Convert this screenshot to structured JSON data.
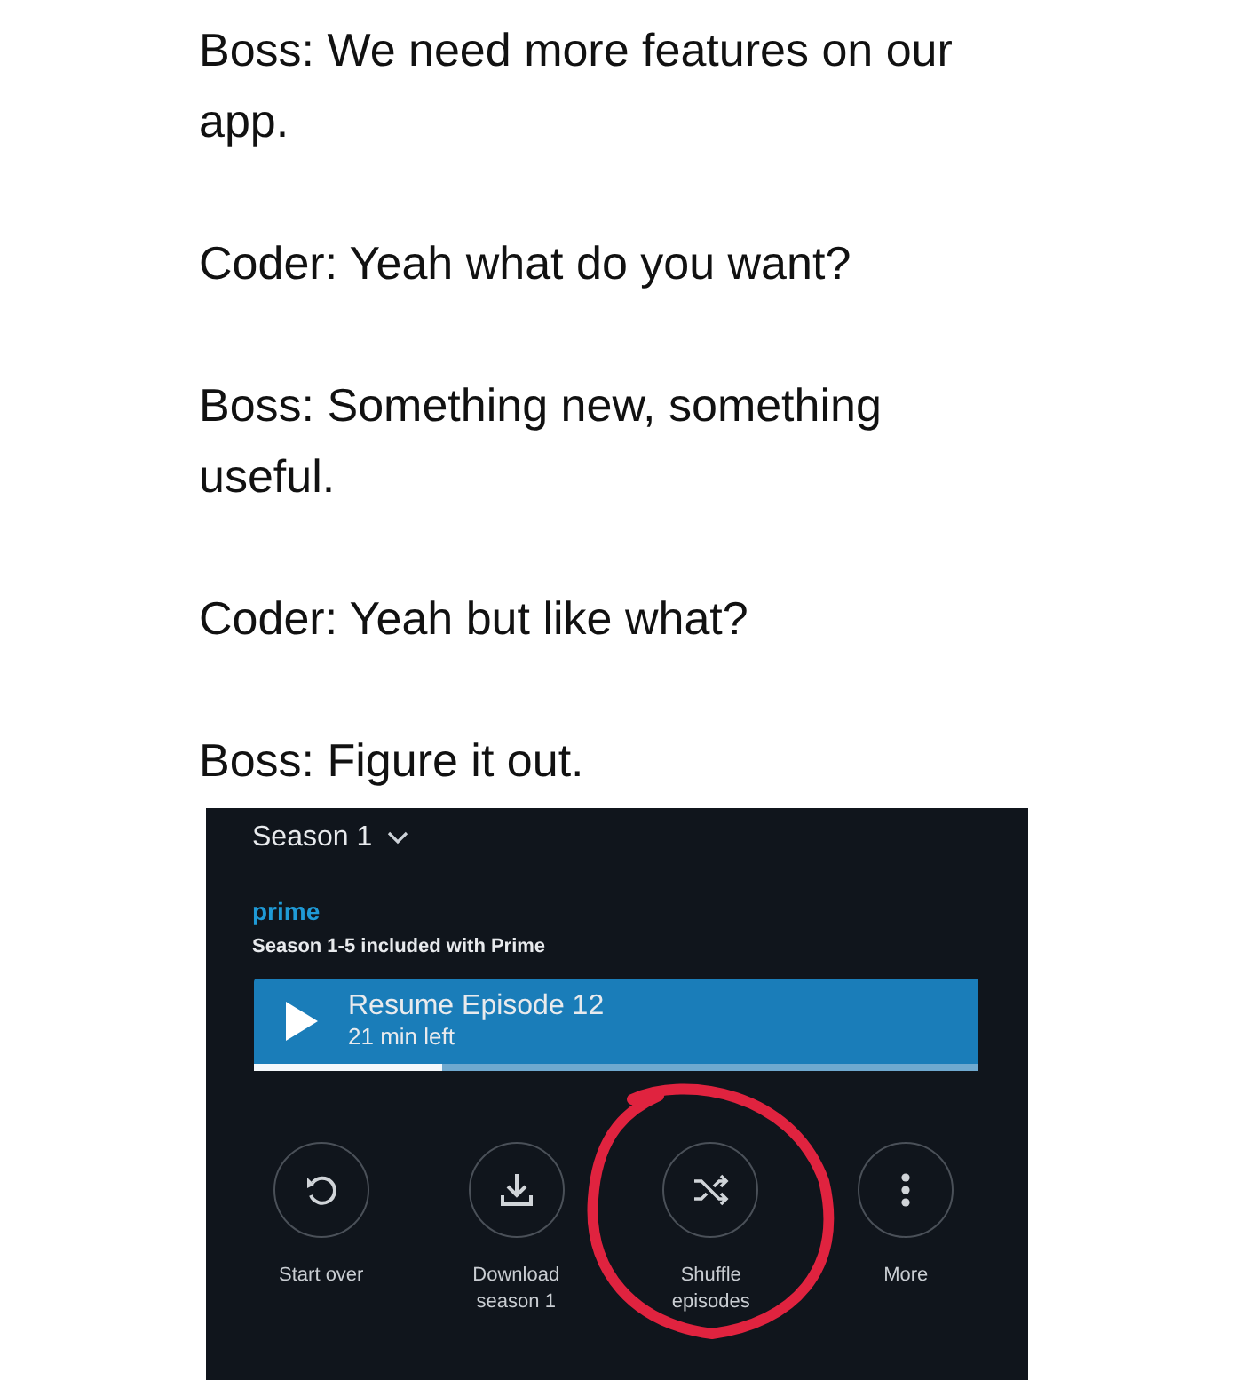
{
  "post": {
    "paragraphs": [
      "Boss: We need more features on our app.",
      "Coder: Yeah what do you want?",
      "Boss: Something new, something useful.",
      "Coder: Yeah but like what?",
      "Boss: Figure it out."
    ]
  },
  "screenshot": {
    "season_selector": "Season 1",
    "brand": "prime",
    "included_note": "Season 1-5 included with Prime",
    "resume": {
      "title": "Resume Episode 12",
      "subtitle": "21 min left",
      "level": 0.26
    },
    "actions": [
      {
        "kind": "restart",
        "label": "Start over",
        "circled": false
      },
      {
        "kind": "download",
        "label": "Download season 1",
        "circled": false
      },
      {
        "kind": "shuffle",
        "label": "Shuffle episodes",
        "circled": true
      },
      {
        "kind": "more",
        "label": "More",
        "circled": false
      }
    ]
  }
}
